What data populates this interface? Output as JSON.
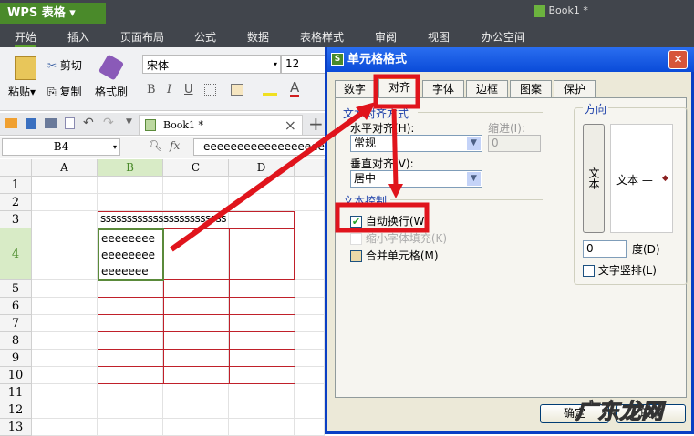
{
  "app": {
    "title": "WPS 表格",
    "document": "Book1 *"
  },
  "menu": [
    "开始",
    "插入",
    "页面布局",
    "公式",
    "数据",
    "表格样式",
    "审阅",
    "视图",
    "办公空间"
  ],
  "ribbon": {
    "paste": "粘贴",
    "cut": "剪切",
    "copy": "复制",
    "format_painter": "格式刷",
    "font": "宋体",
    "size": "12",
    "bold": "B",
    "italic": "I",
    "underline": "U",
    "font_color": "A"
  },
  "tab": {
    "label": "Book1 *",
    "close": "×",
    "add": "+"
  },
  "formula_bar": {
    "name_box": "B4",
    "fx": "fx",
    "content": "eeeeeeeeeeeeeeeeeeee"
  },
  "sheet": {
    "columns": [
      "A",
      "B",
      "C",
      "D"
    ],
    "rows": [
      "1",
      "2",
      "3",
      "4",
      "5",
      "6",
      "7",
      "8",
      "9",
      "10",
      "11",
      "12",
      "13"
    ],
    "b3": "ssssssssssssssssssssssss",
    "b4_lines": [
      "eeeeeeee",
      "eeeeeeee",
      "eeeeeee"
    ]
  },
  "dialog": {
    "title": "单元格格式",
    "close": "✕",
    "tabs": [
      "数字",
      "对齐",
      "字体",
      "边框",
      "图案",
      "保护"
    ],
    "text_align_group": "文本对齐方式",
    "horizontal_label": "水平对齐(H):",
    "horizontal_value": "常规",
    "indent_label": "缩进(I):",
    "indent_value": "0",
    "vertical_label": "垂直对齐(V):",
    "vertical_value": "居中",
    "text_control_group": "文本控制",
    "wrap_text": "自动换行(W)",
    "shrink_to_fit": "缩小字体填充(K)",
    "merge_cells": "合并单元格(M)",
    "orientation_group": "方向",
    "vertical_text_button": "文本",
    "orientation_text": "文本 —",
    "degrees_value": "0",
    "degrees_label": "度(D)",
    "stack_text": "文字竖排(L)",
    "ok": "确定",
    "cancel": "取消"
  },
  "watermark": "广东龙网",
  "colors": {
    "accent": "#4a8a2a",
    "annotation": "#e0141c",
    "dialog_title": "#0a4bd8"
  }
}
